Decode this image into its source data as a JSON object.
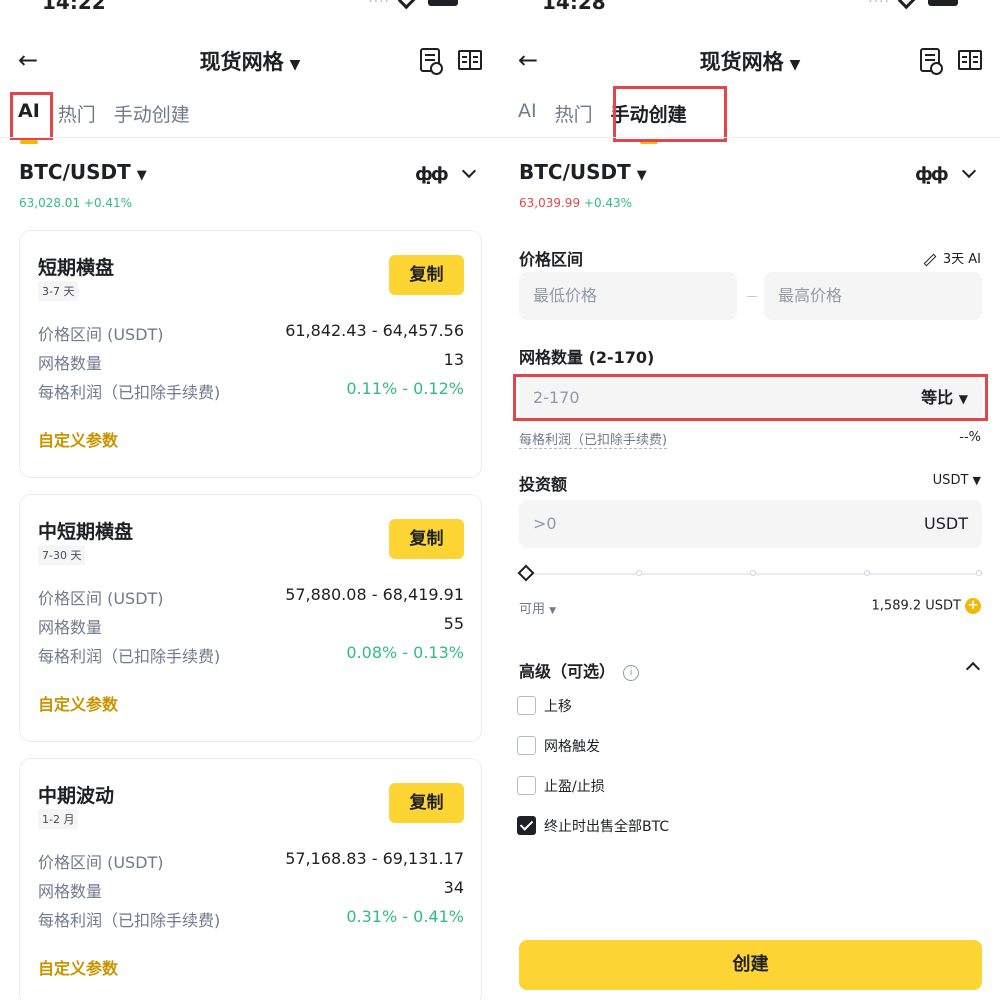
{
  "left": {
    "status_time": "14:22",
    "title": "现货网格",
    "tabs": [
      "AI",
      "热门",
      "手动创建"
    ],
    "pair": "BTC/USDT",
    "price": "63,028.01",
    "change": "+0.41%",
    "cards": [
      {
        "title": "短期横盘",
        "badge": "3-7 天",
        "copy": "复制",
        "range_label": "价格区间 (USDT)",
        "range_value": "61,842.43 - 64,457.56",
        "grid_label": "网格数量",
        "grid_value": "13",
        "profit_label": "每格利润（已扣除手续费)",
        "profit_value": "0.11% - 0.12%",
        "custom": "自定义参数"
      },
      {
        "title": "中短期横盘",
        "badge": "7-30 天",
        "copy": "复制",
        "range_label": "价格区间 (USDT)",
        "range_value": "57,880.08 - 68,419.91",
        "grid_label": "网格数量",
        "grid_value": "55",
        "profit_label": "每格利润（已扣除手续费)",
        "profit_value": "0.08% - 0.13%",
        "custom": "自定义参数"
      },
      {
        "title": "中期波动",
        "badge": "1-2 月",
        "copy": "复制",
        "range_label": "价格区间 (USDT)",
        "range_value": "57,168.83 - 69,131.17",
        "grid_label": "网格数量",
        "grid_value": "34",
        "profit_label": "每格利润（已扣除手续费)",
        "profit_value": "0.31% - 0.41%",
        "custom": "自定义参数"
      }
    ]
  },
  "right": {
    "status_time": "14:28",
    "title": "现货网格",
    "tabs": [
      "AI",
      "热门",
      "手动创建"
    ],
    "pair": "BTC/USDT",
    "price": "63,039.99",
    "change": "+0.43%",
    "price_range_label": "价格区间",
    "ai_hint": "3天 AI",
    "min_price_placeholder": "最低价格",
    "max_price_placeholder": "最高价格",
    "grid_count_label": "网格数量 (2-170)",
    "grid_count_placeholder": "2-170",
    "grid_mode": "等比",
    "profit_per_grid_label": "每格利润（已扣除手续费)",
    "profit_per_grid_value": "--%",
    "invest_label": "投资额",
    "invest_currency": "USDT",
    "invest_placeholder": ">0",
    "invest_suffix": "USDT",
    "available_label": "可用",
    "available_value": "1,589.2 USDT",
    "advanced_label": "高级（可选）",
    "options": [
      {
        "label": "上移",
        "checked": false
      },
      {
        "label": "网格触发",
        "checked": false
      },
      {
        "label": "止盈/止损",
        "checked": false
      },
      {
        "label": "终止时出售全部BTC",
        "checked": true
      }
    ],
    "create_button": "创建"
  },
  "colors": {
    "accent": "#fcd535",
    "up_green": "#2ebd85",
    "down_red": "#e0474b",
    "link_gold": "#c99400",
    "highlight_box": "#e0474b"
  },
  "icons": [
    "back-arrow-icon",
    "caret-down-icon",
    "order-history-icon",
    "guide-book-icon",
    "candlestick-icon",
    "chevron-down-icon",
    "pen-icon",
    "coin-plus-icon",
    "info-icon",
    "chevron-up-icon",
    "checkbox-icon"
  ]
}
